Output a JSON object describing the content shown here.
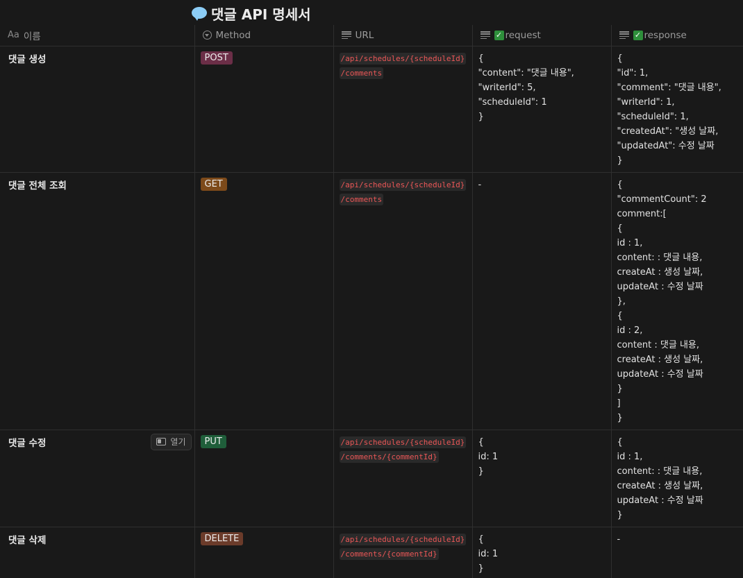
{
  "page": {
    "title": "댓글 API 명세서",
    "emoji_icon": "speech-bubble-icon"
  },
  "columns": [
    {
      "label": "이름",
      "icon_text": "Aa",
      "icon": "title-property-icon"
    },
    {
      "label": "Method",
      "icon": "select-property-icon"
    },
    {
      "label": "URL",
      "icon": "text-property-icon"
    },
    {
      "label": "request",
      "icon": "text-property-icon",
      "checkbox": true
    },
    {
      "label": "response",
      "icon": "text-property-icon",
      "checkbox": true
    }
  ],
  "open_button_label": "열기",
  "rows": [
    {
      "name": "댓글 생성",
      "method": "POST",
      "url": [
        "/api/schedules/{scheduleId}",
        "/comments"
      ],
      "request": [
        "{",
        "\"content\": \"댓글 내용\",",
        "\"writerId\": 5,",
        "\"scheduleId\": 1",
        "}"
      ],
      "response": [
        "{",
        "\"id\": 1,",
        "\"comment\": \"댓글 내용\",",
        "\"writerId\": 1,",
        "\"scheduleId\": 1,",
        "\"createdAt\": \"생성 날짜,",
        "\"updatedAt\": 수정 날짜",
        "}"
      ]
    },
    {
      "name": "댓글 전체 조회",
      "method": "GET",
      "url": [
        "/api/schedules/{scheduleId}",
        "/comments"
      ],
      "request": [
        "-"
      ],
      "response": [
        "{",
        "\"commentCount\": 2",
        "comment:[",
        "{",
        "id : 1,",
        "content: : 댓글 내용,",
        "createAt : 생성 날짜,",
        "updateAt : 수정 날짜",
        "},",
        "{",
        "id : 2,",
        "content : 댓글 내용,",
        "createAt : 생성 날짜,",
        "updateAt : 수정 날짜",
        "}",
        "]",
        "}"
      ]
    },
    {
      "name": "댓글 수정",
      "method": "PUT",
      "url": [
        "/api/schedules/{scheduleId}",
        "/comments/{commentId}"
      ],
      "request": [
        "{",
        "id: 1",
        "}"
      ],
      "response": [
        "{",
        "id : 1,",
        "content: : 댓글 내용,",
        "createAt : 생성 날짜,",
        "updateAt : 수정 날짜",
        "}"
      ]
    },
    {
      "name": "댓글 삭제",
      "method": "DELETE",
      "url": [
        "/api/schedules/{scheduleId}",
        "/comments/{commentId}"
      ],
      "request": [
        "{",
        "id: 1",
        "}"
      ],
      "response": [
        "-"
      ]
    }
  ],
  "colors": {
    "background": "#191919",
    "post_tag": "#6b2e47",
    "get_tag": "#7d4a1a",
    "put_tag": "#1f5e3a",
    "delete_tag": "#6b3b2a",
    "url_text": "#eb5757",
    "checkbox": "#2e8f3b"
  }
}
